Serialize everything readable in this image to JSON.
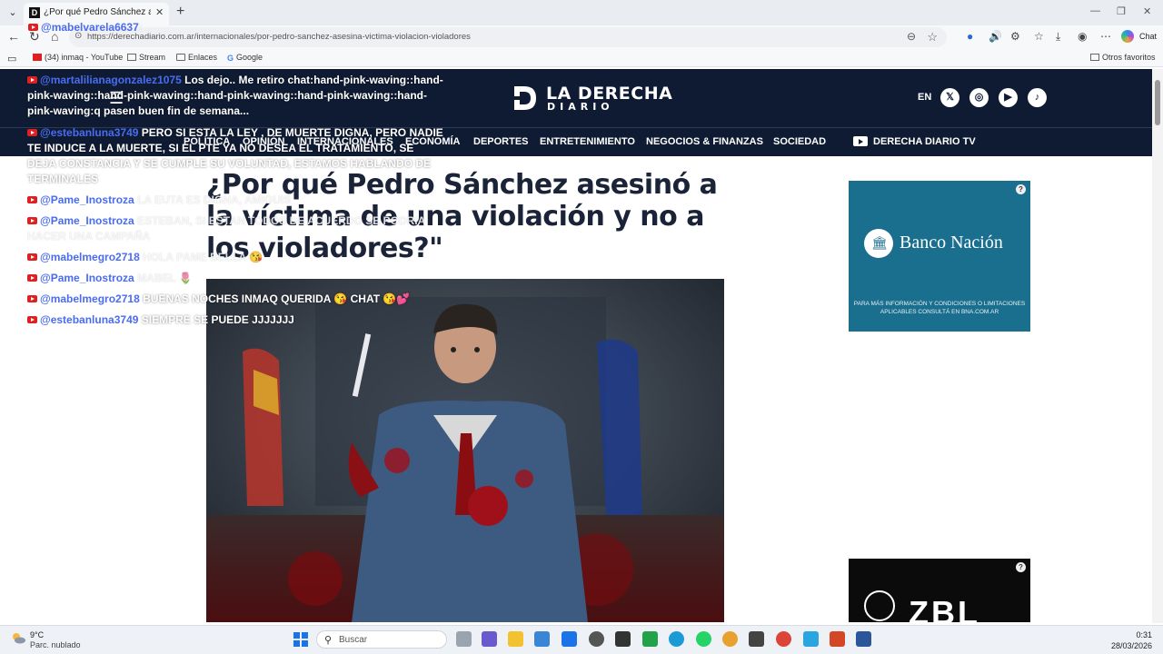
{
  "browser": {
    "tab_title": "¿Por qué Pedro Sánchez asesinó a la víctima de una violación y no a los violadores?\"",
    "tab_close": "✕",
    "new_tab": "+",
    "url": "https://derechadiario.com.ar/internacionales/por-pedro-sanchez-asesina-victima-violacion-violadores",
    "chat_label": "Chat",
    "bookmarks": [
      "(34) inmaq - YouTube",
      "Stream",
      "Enlaces",
      "Google"
    ],
    "other_favorites": "Otros favoritos"
  },
  "site": {
    "logo_line1": "LA DERECHA",
    "logo_line2": "DIARIO",
    "lang": "EN",
    "nav": [
      "POLÍTICA",
      "OPINIÓN",
      "INTERNACIONALES",
      "ECONOMÍA",
      "DEPORTES",
      "ENTRETENIMIENTO",
      "NEGOCIOS & FINANZAS",
      "SOCIEDAD",
      "DERECHA DIARIO TV"
    ],
    "headline": "¿Por qué Pedro Sánchez asesinó a la víctima de una violación y no a los violadores?\"",
    "brand_dark": "#0f1b33"
  },
  "ads": {
    "ad1_name": "Banco Nación",
    "ad1_small": "PARA MÁS INFORMACIÓN Y CONDICIONES O LIMITACIONES APLICABLES CONSULTÁ EN BNA.COM.AR",
    "ad2_text": "ZBL",
    "badge": "?"
  },
  "chat": [
    {
      "user": "@mabelvarela6637",
      "msg": ":"
    },
    {
      "user": "@martalilianagonzalez1075",
      "msg": "Los dejo.. Me retiro chat:hand-pink-waving::hand-pink-waving::hand-pink-waving::hand-pink-waving::hand-pink-waving::hand-pink-waving:q pasen buen fin de semana..."
    },
    {
      "user": "@estebanluna3749",
      "msg": "PERO SI ESTA LA LEY , DE MUERTE DIGNA, PERO NADIE TE INDUCE A LA MUERTE, SI EL PTE YA NO DESEA EL TRATAMIENTO, SE DEJA CONSTANCIA Y SE CUMPLE SU VOLUNTAD, ESTAMOS HABLANDO DE TERMINALES"
    },
    {
      "user": "@Pame_Inostroza",
      "msg": "LA EUTA ES DIGNA, AMIGUIS"
    },
    {
      "user": "@Pame_Inostroza",
      "msg": "ESTEBAN, SI ESTAN TODOS DE ACUERDO SE PODRIA HACER UNA CAMPAÑA"
    },
    {
      "user": "@mabelmegro2718",
      "msg": "HOLA PAME BELLA 😘"
    },
    {
      "user": "@Pame_Inostroza",
      "msg": "MABEL 🌷"
    },
    {
      "user": "@mabelmegro2718",
      "msg": "BUENAS NOCHES INMAQ QUERIDA 😘 CHAT 😘💕"
    },
    {
      "user": "@estebanluna3749",
      "msg": "SIEMPRE SE PUEDE JJJJJJJ"
    }
  ],
  "taskbar": {
    "temp": "9°C",
    "condition": "Parc. nublado",
    "search_placeholder": "Buscar",
    "time": "0:31",
    "date": "28/03/2026"
  }
}
